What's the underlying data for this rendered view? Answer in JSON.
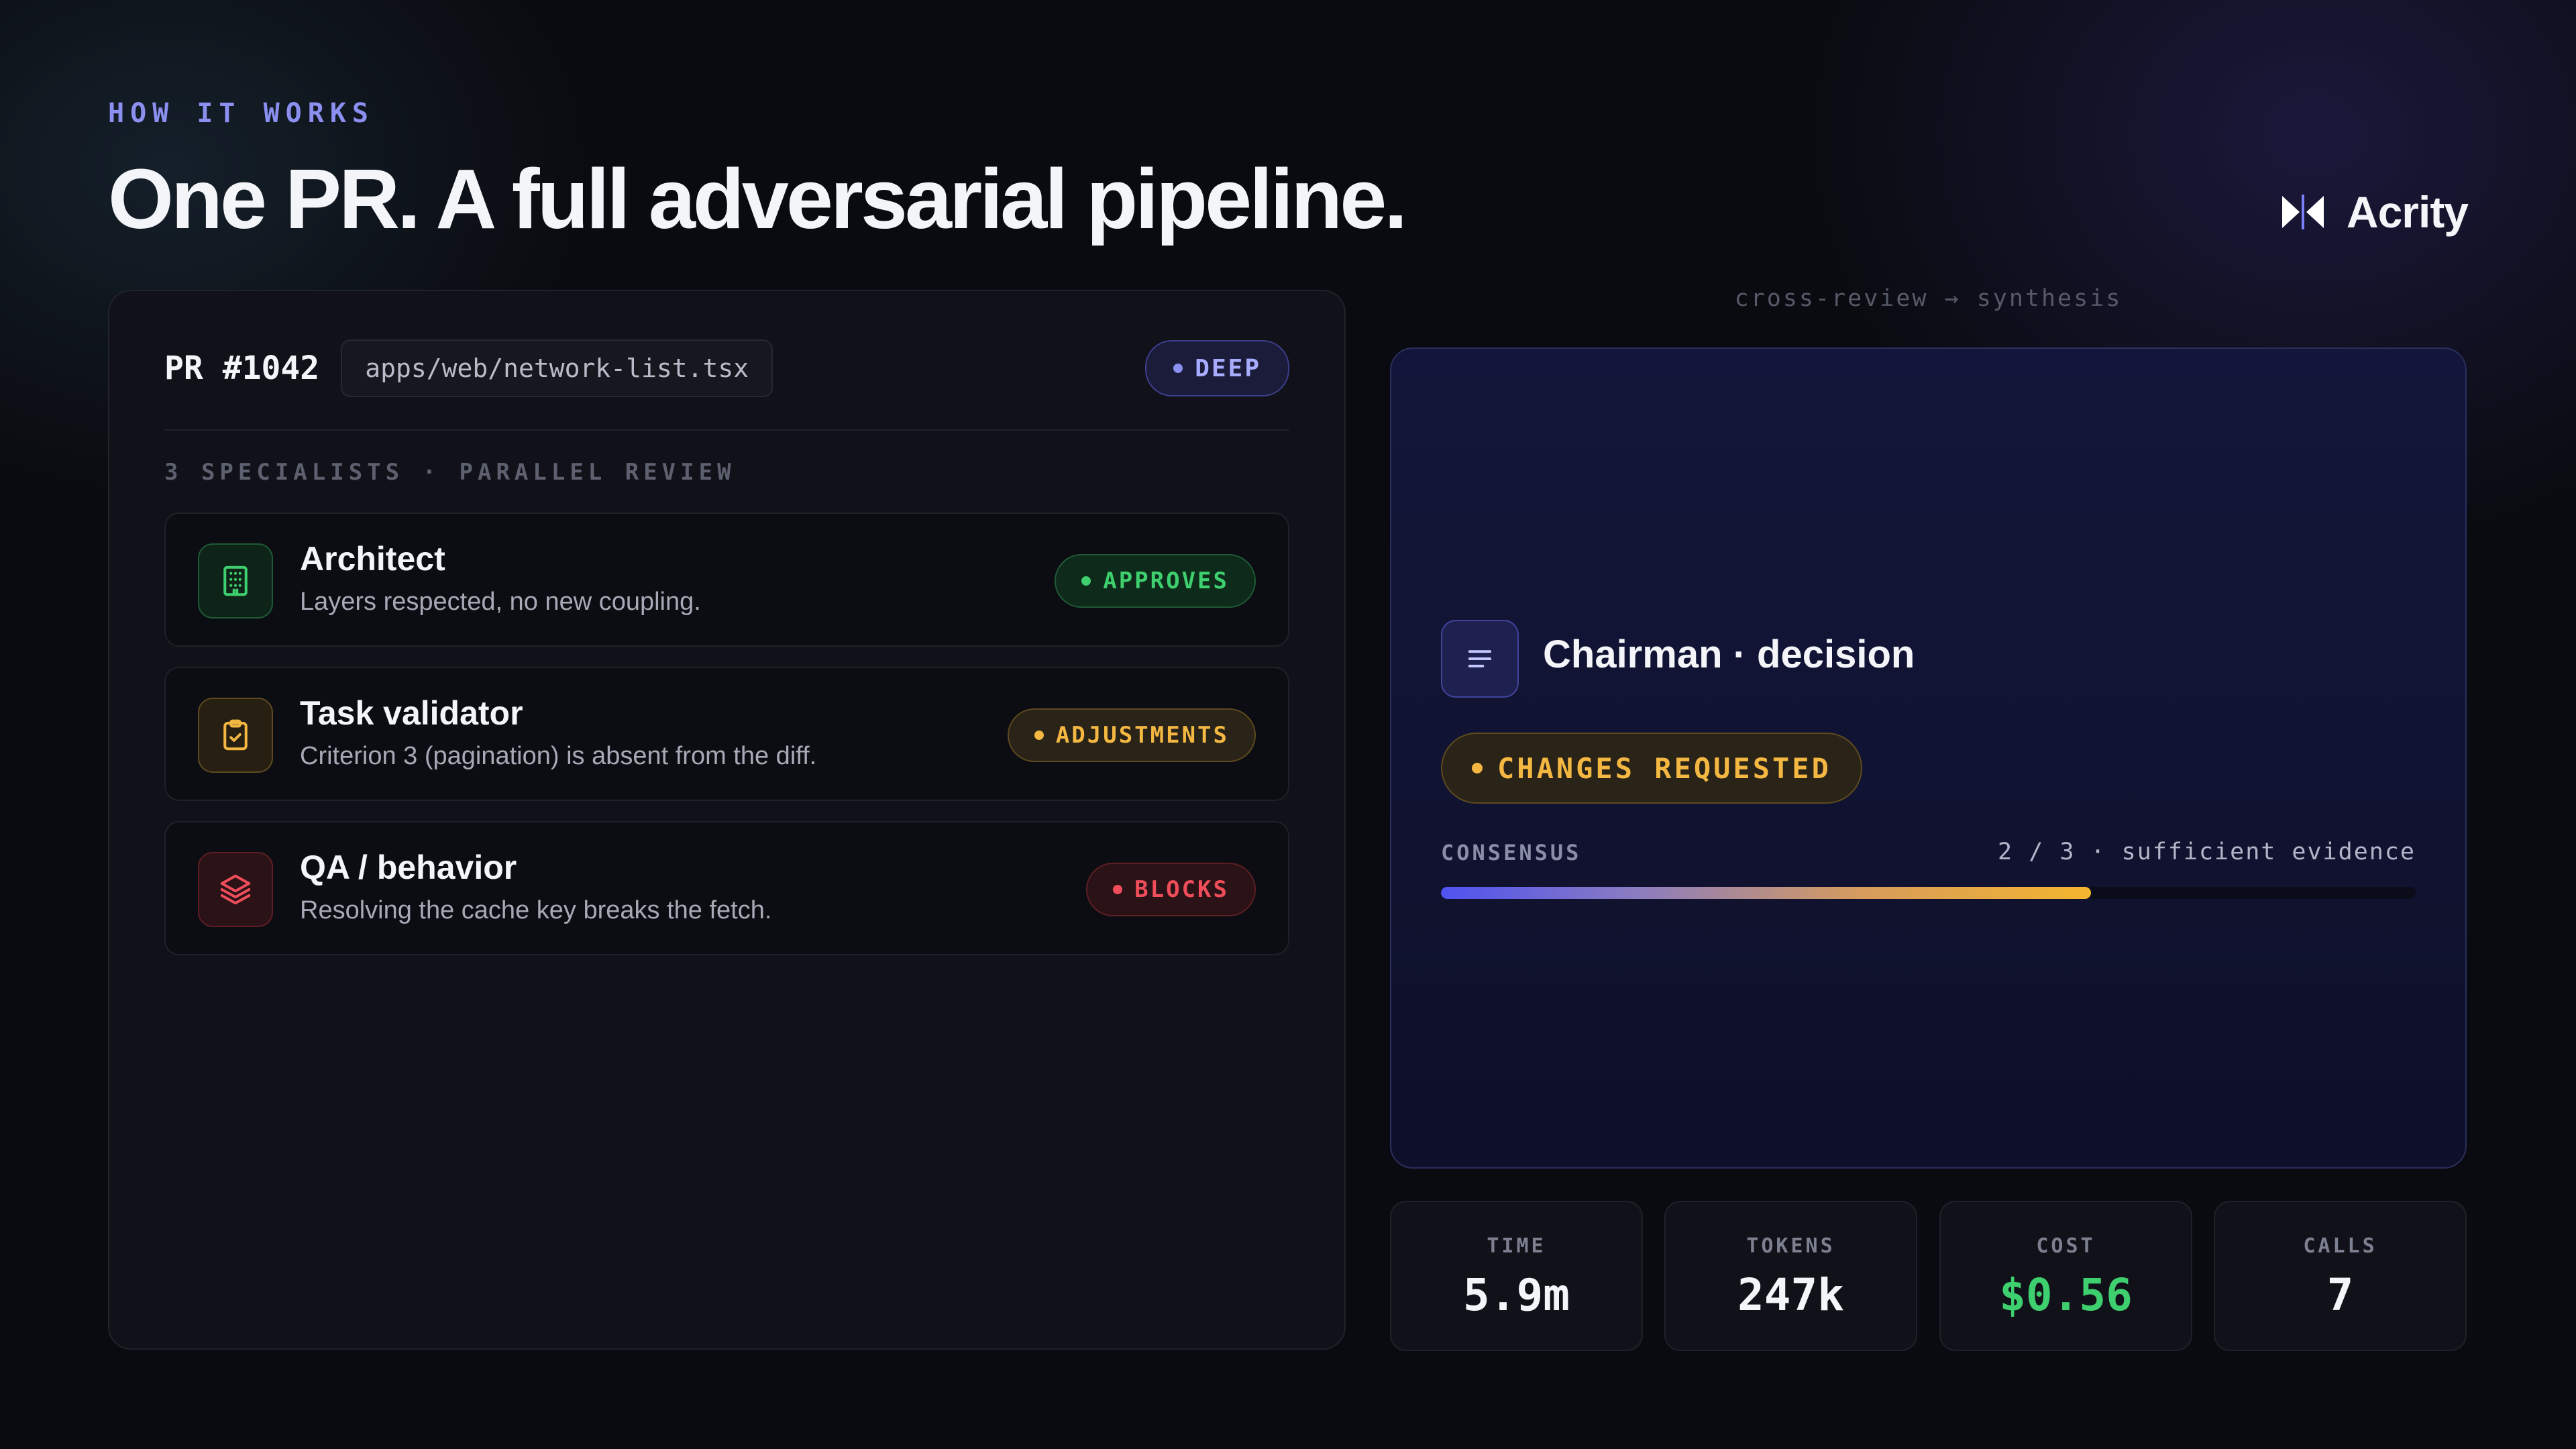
{
  "header": {
    "eyebrow": "HOW IT WORKS",
    "headline": "One PR. A full adversarial pipeline.",
    "brand": "Acrity"
  },
  "pr": {
    "title": "PR #1042",
    "file": "apps/web/network-list.tsx",
    "depth": "DEEP",
    "section_label": "3 SPECIALISTS · PARALLEL REVIEW"
  },
  "specialists": [
    {
      "name": "Architect",
      "description": "Layers respected, no new coupling.",
      "verdict": "APPROVES",
      "icon": "building-icon",
      "color": "#3ecf6e"
    },
    {
      "name": "Task validator",
      "description": "Criterion 3 (pagination) is absent from the diff.",
      "verdict": "ADJUSTMENTS",
      "icon": "clipboard-check-icon",
      "color": "#f3b742"
    },
    {
      "name": "QA / behavior",
      "description": "Resolving the cache key breaks the fetch.",
      "verdict": "BLOCKS",
      "icon": "layers-icon",
      "color": "#ef4d5a"
    }
  ],
  "flow_label": "cross-review → synthesis",
  "chairman": {
    "title": "Chairman · decision",
    "status": "CHANGES REQUESTED",
    "consensus_label": "CONSENSUS",
    "consensus_value": "2 / 3 · sufficient evidence",
    "consensus_fraction": 0.667
  },
  "stats": [
    {
      "label": "TIME",
      "value": "5.9m",
      "color": "#f4f5f9"
    },
    {
      "label": "TOKENS",
      "value": "247k",
      "color": "#f4f5f9"
    },
    {
      "label": "COST",
      "value": "$0.56",
      "color": "#3ecf6e"
    },
    {
      "label": "CALLS",
      "value": "7",
      "color": "#f4f5f9"
    }
  ],
  "colors": {
    "accent": "#8b8ff0",
    "approve": "#3ecf6e",
    "adjust": "#f3b742",
    "block": "#ef4d5a"
  }
}
